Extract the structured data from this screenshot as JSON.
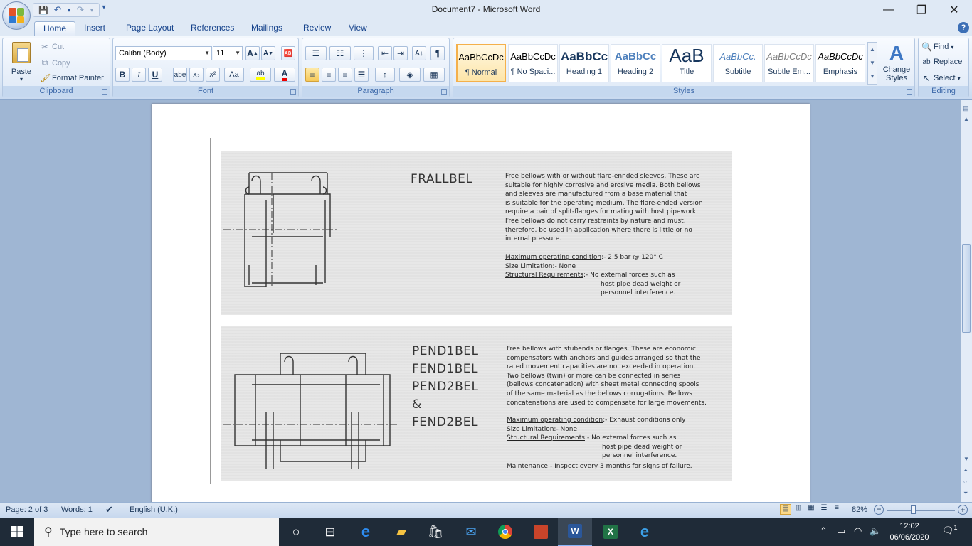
{
  "window": {
    "title": "Document7 - Microsoft Word",
    "minimize": "—",
    "restore": "❐",
    "close": "✕"
  },
  "qat": {
    "save": "💾",
    "undo": "↶",
    "redo": "↷",
    "more": "▾"
  },
  "tabs": [
    "Home",
    "Insert",
    "Page Layout",
    "References",
    "Mailings",
    "Review",
    "View"
  ],
  "clipboard": {
    "label": "Clipboard",
    "paste": "Paste",
    "cut": "Cut",
    "copy": "Copy",
    "format_painter": "Format Painter"
  },
  "font": {
    "label": "Font",
    "family": "Calibri (Body)",
    "size": "11",
    "bold": "B",
    "italic": "I",
    "underline": "U",
    "strike": "abe",
    "subscript": "x₂",
    "superscript": "x²",
    "change_case": "Aa",
    "grow": "A",
    "shrink": "A"
  },
  "paragraph": {
    "label": "Paragraph"
  },
  "styles": {
    "label": "Styles",
    "items": [
      {
        "sample": "AaBbCcDc",
        "name": "¶ Normal"
      },
      {
        "sample": "AaBbCcDc",
        "name": "¶ No Spaci..."
      },
      {
        "sample": "AaBbCc",
        "name": "Heading 1"
      },
      {
        "sample": "AaBbCc",
        "name": "Heading 2"
      },
      {
        "sample": "AaB",
        "name": "Title"
      },
      {
        "sample": "AaBbCc.",
        "name": "Subtitle"
      },
      {
        "sample": "AaBbCcDc",
        "name": "Subtle Em..."
      },
      {
        "sample": "AaBbCcDc",
        "name": "Emphasis"
      }
    ],
    "change_styles": "Change Styles"
  },
  "editing": {
    "label": "Editing",
    "find": "Find",
    "replace": "Replace",
    "select": "Select"
  },
  "document": {
    "figure1": {
      "title": "FRALLBEL",
      "desc": [
        "Free bellows with or without flare-ennded sleeves. These are",
        "suitable for highly corrosive and erosive media. Both bellows",
        "and sleeves are manufactured from a base material that",
        "is suitable for the operating medium. The flare-ended version",
        "require a pair of split-flanges for mating with host pipework.",
        "Free bellows do not carry restraints by nature and must,",
        "therefore, be used in application where there is little or no",
        "internal pressure."
      ],
      "spec_moc_label": "Maximum operating condition",
      "spec_moc_value": ":-  2.5 bar @ 120° C",
      "spec_size_label": "Size Limitation",
      "spec_size_value": ":-  None",
      "spec_struct_label": "Structural Requirements",
      "spec_struct_value": [
        ":-  No external forces such as",
        "host pipe dead weight or",
        "personnel interference."
      ]
    },
    "figure2": {
      "titles": [
        "PEND1BEL",
        "FEND1BEL",
        "PEND2BEL",
        "&",
        "FEND2BEL"
      ],
      "desc": [
        "Free bellows with stubends or flanges. These are economic",
        "compensators with anchors and guides arranged so that the",
        "rated movement capacities are not exceeded in operation.",
        "Two bellows (twin) or more can be connected in series",
        "(bellows concatenation) with sheet metal connecting spools",
        "of the same material as the bellows corrugations. Bellows",
        "concatenations are used to compensate for large movements."
      ],
      "spec_moc_label": "Maximum operating condition",
      "spec_moc_value": ":-  Exhaust conditions only",
      "spec_size_label": "Size Limitation",
      "spec_size_value": ":-  None",
      "spec_struct_label": "Structural Requirements",
      "spec_struct_value": [
        ":-  No external forces such as",
        "host pipe dead weight or",
        "personnel interference."
      ],
      "spec_maint_label": "Maintenance",
      "spec_maint_value": ":-  Inspect every 3 months for signs of failure."
    }
  },
  "status": {
    "page": "Page: 2 of 3",
    "words": "Words: 1",
    "language": "English (U.K.)",
    "zoom": "82%"
  },
  "taskbar": {
    "search_placeholder": "Type here to search",
    "time": "12:02",
    "date": "06/06/2020",
    "notifications": "1"
  }
}
